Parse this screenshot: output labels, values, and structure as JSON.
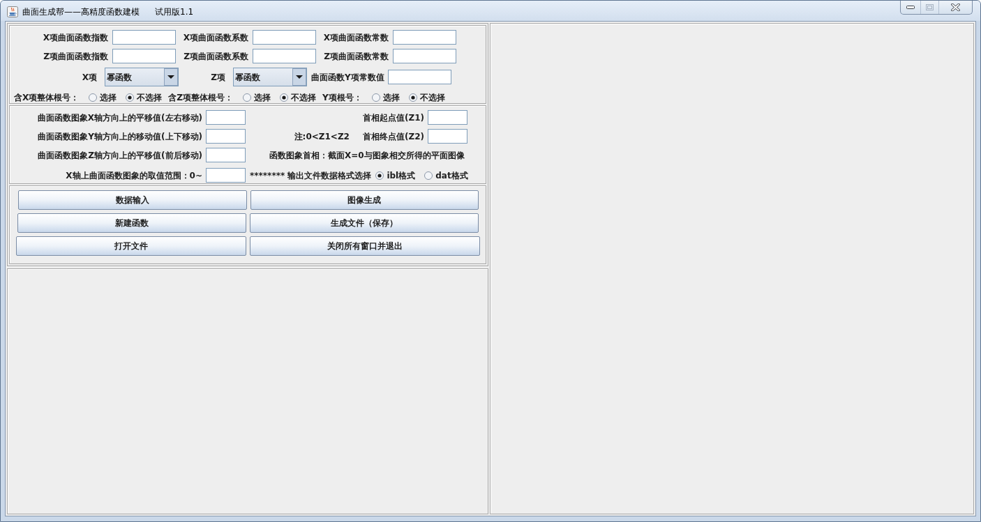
{
  "window": {
    "title": "曲面生成帮——高精度函数建模",
    "version": "试用版1.1",
    "controls": [
      {
        "kind": "minimize",
        "disabled": false
      },
      {
        "kind": "maximize",
        "disabled": true
      },
      {
        "kind": "close",
        "disabled": false
      }
    ]
  },
  "function_settings": {
    "coefficient_fields": [
      {
        "label": "X项曲面函数指数"
      },
      {
        "label": "X项曲面函数系数"
      },
      {
        "label": "X项曲面函数常数"
      },
      {
        "label": "Z项曲面函数指数"
      },
      {
        "label": "Z项曲面函数系数"
      },
      {
        "label": "Z项曲面函数常数"
      }
    ],
    "term_types": [
      {
        "label": "X项",
        "value": "幂函数"
      },
      {
        "label": "Z项",
        "value": "幂函数"
      }
    ],
    "y_constant_field": {
      "label": "曲面函数Y项常数值"
    },
    "root_options": [
      {
        "label": "含X项整体根号：",
        "options": [
          {
            "label": "选择",
            "selected": false
          },
          {
            "label": "不选择",
            "selected": true
          }
        ]
      },
      {
        "label": "含Z项整体根号：",
        "options": [
          {
            "label": "选择",
            "selected": false
          },
          {
            "label": "不选择",
            "selected": true
          }
        ]
      },
      {
        "label": "Y项根号：",
        "options": [
          {
            "label": "选择",
            "selected": false
          },
          {
            "label": "不选择",
            "selected": true
          }
        ]
      }
    ]
  },
  "transform_settings": {
    "shift_fields": [
      {
        "label": "曲面函数图象X轴方向上的平移值(左右移动)"
      },
      {
        "label": "曲面函数图象Y轴方向上的移动值(上下移动)"
      },
      {
        "label": "曲面函数图象Z轴方向上的平移值(前后移动)"
      },
      {
        "label": "X轴上曲面函数图象的取值范围：0~"
      }
    ],
    "first_phase": {
      "fields": [
        {
          "label": "首相起点值(Z1)"
        },
        {
          "label": "首相终点值(Z2)"
        }
      ],
      "note": "注:0<Z1<Z2",
      "description": "函数图象首相：截面X=0与图象相交所得的平面图像"
    },
    "output_format": {
      "label": "******** 输出文件数据格式选择",
      "options": [
        {
          "label": "ibl格式",
          "selected": true
        },
        {
          "label": "dat格式",
          "selected": false
        }
      ]
    }
  },
  "buttons": [
    "数据输入",
    "图像生成",
    "新建函数",
    "生成文件（保存）",
    "打开文件",
    "关闭所有窗口并退出"
  ]
}
